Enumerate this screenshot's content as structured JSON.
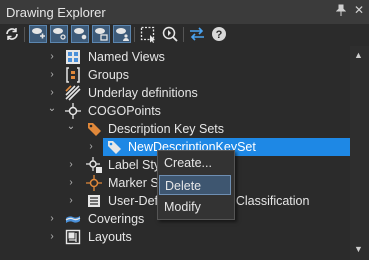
{
  "window": {
    "title": "Drawing Explorer",
    "pin_glyph": "↕",
    "close_glyph": "✕"
  },
  "toolbar": {
    "buttons": [
      {
        "icon": "refresh-icon",
        "active": false
      },
      {
        "icon": "add-node-icon",
        "active": true
      },
      {
        "icon": "node-filter-icon",
        "active": true
      },
      {
        "icon": "node-props-icon",
        "active": true
      },
      {
        "icon": "node-group-icon",
        "active": true
      },
      {
        "icon": "node-user-icon",
        "active": true
      },
      {
        "icon": "select-region-icon",
        "active": false
      },
      {
        "icon": "zoom-select-icon",
        "active": false
      },
      {
        "icon": "sync-arrows-icon",
        "active": false
      },
      {
        "icon": "help-icon",
        "active": false
      }
    ],
    "help_glyph": "?"
  },
  "tree": {
    "items": [
      {
        "label": "Named Views",
        "expander": "›",
        "icon": "named-views-icon"
      },
      {
        "label": "Groups",
        "expander": "›",
        "icon": "groups-icon"
      },
      {
        "label": "Underlay definitions",
        "expander": "›",
        "icon": "underlay-icon"
      },
      {
        "label": "COGOPoints",
        "expander": "⌄",
        "icon": "cogo-points-icon"
      },
      {
        "label": "Description Key Sets",
        "expander": "⌄",
        "icon": "tag-icon"
      },
      {
        "label": "NewDescriptionKeySet",
        "expander": "›",
        "icon": "tag-icon",
        "selected": true
      },
      {
        "label": "Label Styles",
        "expander": "›",
        "icon": "label-styles-icon"
      },
      {
        "label": "Marker Styles",
        "expander": "›",
        "icon": "marker-styles-icon"
      },
      {
        "label": "User-Defined Property Classification",
        "expander": "›",
        "icon": "user-defined-icon"
      },
      {
        "label": "Coverings",
        "expander": "›",
        "icon": "coverings-icon"
      },
      {
        "label": "Layouts",
        "expander": "›",
        "icon": "layouts-icon"
      }
    ]
  },
  "context_menu": {
    "items": [
      {
        "label": "Create...",
        "hover": false
      },
      {
        "label": "Delete",
        "hover": true
      },
      {
        "label": "Modify",
        "hover": false
      }
    ]
  },
  "scrollbar": {
    "up": "▲",
    "down": "▼"
  },
  "colors": {
    "panel_bg": "#2b2b2b",
    "selection": "#1e88e5",
    "accent_icon": "#e0883a",
    "active_button": "#3d5a78"
  }
}
